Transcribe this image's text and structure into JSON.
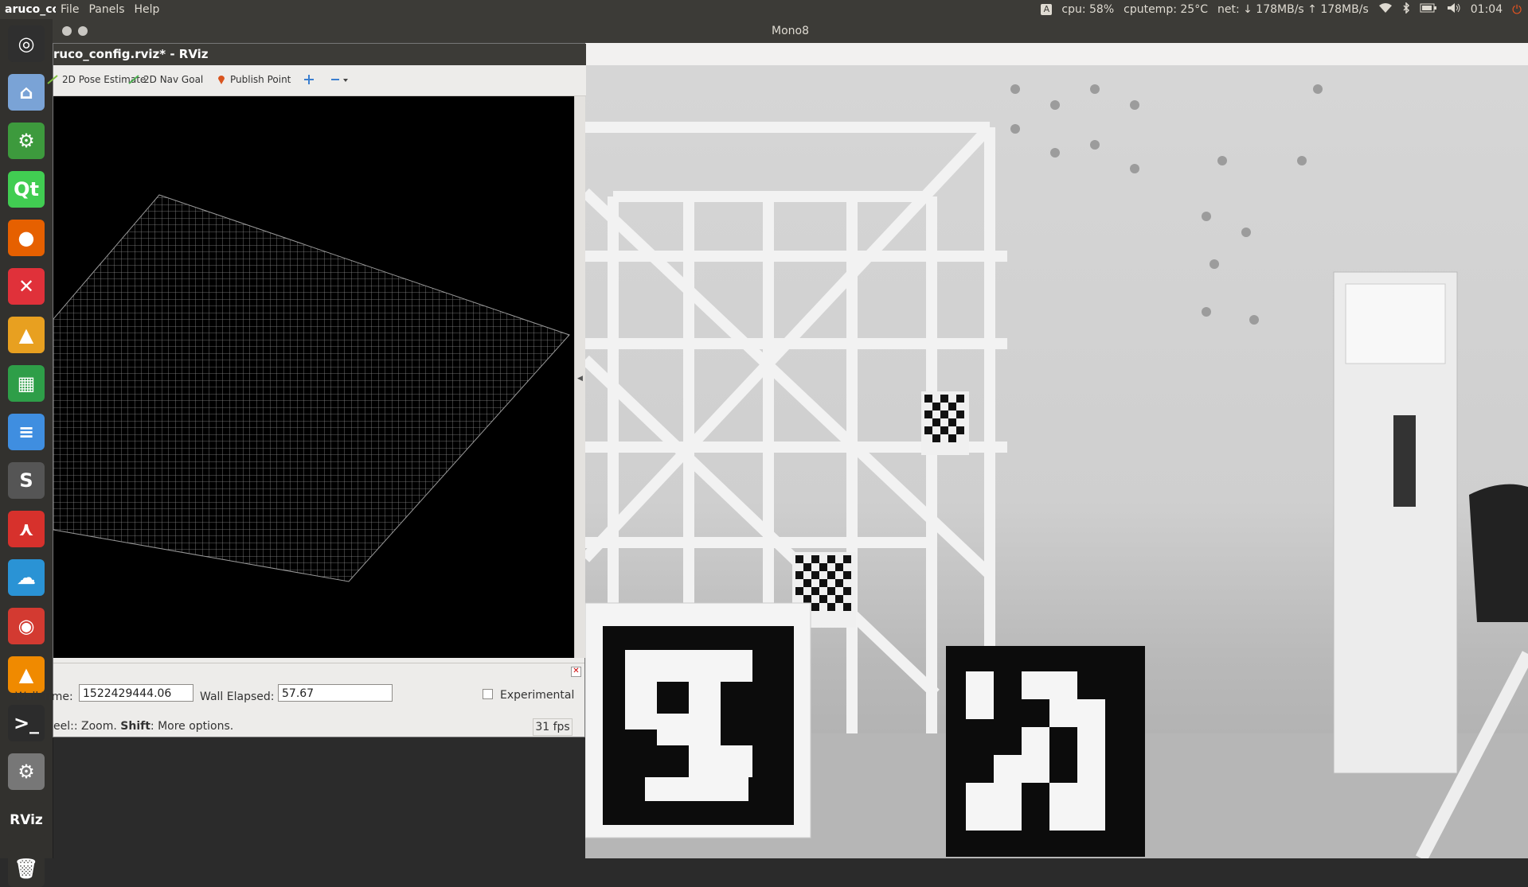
{
  "top_panel": {
    "app_name": "aruco_co",
    "menus": [
      "File",
      "Panels",
      "Help"
    ],
    "keyboard_indicator": "A",
    "cpu": "cpu: 58%",
    "cputemp": "cputemp: 25°C",
    "net": "net: ↓ 178MB/s ↑ 178MB/s",
    "clock": "01:04",
    "icons": [
      "keyboard-icon",
      "wifi-icon",
      "bluetooth-icon",
      "battery-icon",
      "volume-icon",
      "power-icon"
    ]
  },
  "launcher": {
    "items": [
      {
        "name": "ubuntu-dash",
        "glyph": "◎",
        "color": "#2f2f2f"
      },
      {
        "name": "files",
        "glyph": "⌂",
        "color": "#7aa3d6"
      },
      {
        "name": "robot-app",
        "glyph": "⚙",
        "color": "#3d9a3d"
      },
      {
        "name": "qt-creator",
        "glyph": "Qt",
        "color": "#41cd52"
      },
      {
        "name": "firefox",
        "glyph": "●",
        "color": "#e66000"
      },
      {
        "name": "xmind",
        "glyph": "✕",
        "color": "#e0313a"
      },
      {
        "name": "image-viewer",
        "glyph": "▲",
        "color": "#e8a020"
      },
      {
        "name": "spreadsheet",
        "glyph": "▦",
        "color": "#2e9e48"
      },
      {
        "name": "text-editor",
        "glyph": "≡",
        "color": "#3f8ee0"
      },
      {
        "name": "sublime",
        "glyph": "S",
        "color": "#555"
      },
      {
        "name": "pdf-reader",
        "glyph": "⋏",
        "color": "#d7312c"
      },
      {
        "name": "cloud-app",
        "glyph": "☁",
        "color": "#2a93d5"
      },
      {
        "name": "netease-music",
        "glyph": "◉",
        "color": "#d33a31"
      },
      {
        "name": "vlc",
        "glyph": "▲",
        "color": "#f08a00"
      },
      {
        "name": "terminal",
        "glyph": ">_",
        "color": "#2c2c2c"
      },
      {
        "name": "settings",
        "glyph": "⚙",
        "color": "#777"
      },
      {
        "name": "rviz",
        "glyph": "RViz",
        "color": "#32312e"
      },
      {
        "name": "trash",
        "glyph": "🗑",
        "color": "#32312e"
      }
    ]
  },
  "mono_window": {
    "title": "Mono8"
  },
  "rviz_window": {
    "title": "ruco_config.rviz* - RViz",
    "toolbar": {
      "pose_estimate": "2D Pose Estimate",
      "nav_goal": "2D Nav Goal",
      "publish_point": "Publish Point"
    },
    "time_panel": {
      "wall_time_label": "Wall Time:",
      "wall_time_value": "1522429444.06",
      "wall_elapsed_label": "Wall Elapsed:",
      "wall_elapsed_value": "57.67",
      "experimental_label": "Experimental"
    },
    "status": {
      "message_prefix": "eel:: Zoom. ",
      "message_bold": "Shift",
      "message_suffix": ": More options.",
      "fps": "31 fps"
    }
  }
}
